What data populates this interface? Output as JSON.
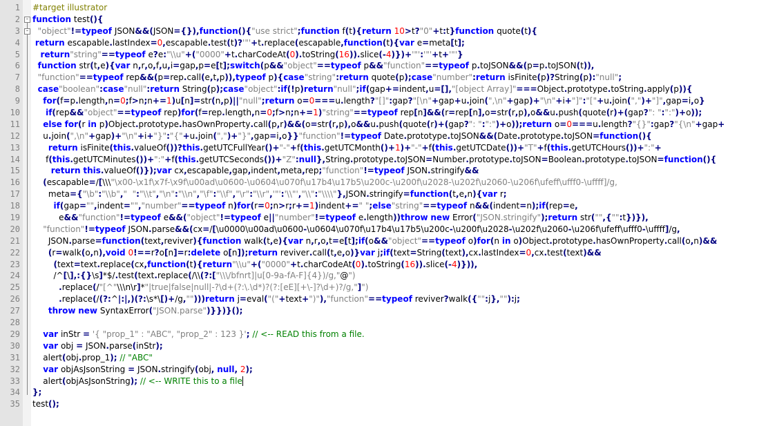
{
  "editor": {
    "title": "",
    "lines": [
      "#target illustrator",
      "function test(){",
      "  \"object\"!=typeof JSON&&(JSON={}),function(){\"use strict\";function f(t){return 10>t?\"0\"+t:t}function quote(t){",
      " return escapable.lastIndex=0,escapable.test(t)?'\"'+t.replace(escapable,function(t){var e=meta[t];",
      "   return\"string\"==typeof e?e:\"\\\\u\"+(\"0000\"+t.charCodeAt(0).toString(16)).slice(-4)})+'\"':'\"'+t+'\"'}",
      "  function str(t,e){var n,r,o,f,u,i=gap,p=e[t];switch(p&&\"object\"==typeof p&&\"function\"==typeof p.toJSON&&(p=p.toJSON(t)),",
      "  \"function\"==typeof rep&&(p=rep.call(e,t,p)),typeof p){case\"string\":return quote(p);case\"number\":return isFinite(p)?String(p):\"null\";",
      "  case\"boolean\":case\"null\":return String(p);case\"object\":if(!p)return\"null\";if(gap+=indent,u=[],\"[object Array]\"===Object.prototype.toString.apply(p)){",
      "    for(f=p.length,n=0;f>n;n+=1)u[n]=str(n,p)||\"null\";return o=0===u.length?\"[]\":gap?\"[\\n\"+gap+u.join(\",\\n\"+gap)+\"\\n\"+i+\"]\":\"[\"+u.join(\",\")+\"]\",gap=i,o}",
      "     if(rep&&\"object\"==typeof rep)for(f=rep.length,n=0;f>n;n+=1)\"string\"==typeof rep[n]&&(r=rep[n],o=str(r,p),o&&u.push(quote(r)+(gap?\": \":\":\")+o));",
      "    else for(r in p)Object.prototype.hasOwnProperty.call(p,r)&&(o=str(r,p),o&&u.push(quote(r)+(gap?\": \":\":\")+o));return o=0===u.length?\"{}\":gap?\"{\\n\"+gap+",
      "    u.join(\",\\n\"+gap)+\"\\n\"+i+\"}\":\"{\"+u.join(\",\")+\"}\",gap=i,o}}\"function\"!=typeof Date.prototype.toJSON&&(Date.prototype.toJSON=function(){",
      "      return isFinite(this.valueOf())?this.getUTCFullYear()+\"-\"+f(this.getUTCMonth()+1)+\"-\"+f(this.getUTCDate())+\"T\"+f(this.getUTCHours())+\":\"+",
      "     f(this.getUTCMinutes())+\":\"+f(this.getUTCSeconds())+\"Z\":null},String.prototype.toJSON=Number.prototype.toJSON=Boolean.prototype.toJSON=function(){",
      "       return this.valueOf()});var cx,escapable,gap,indent,meta,rep;\"function\"!=typeof JSON.stringify&&",
      "    (escapable=/[\\\\\\\"\\x00-\\x1f\\x7f-\\x9f\\u00ad\\u0600-\\u0604\\u070f\\u17b4\\u17b5\\u200c-\\u200f\\u2028-\\u202f\\u2060-\\u206f\\ufeff\\ufff0-\\uffff]/g,",
      "      meta={\"\\b\":\"\\\\b\",\"  \":\"\\\\t\",\"\\n\":\"\\\\n\",\"\\f\":\"\\\\f\",\"\\r\":\"\\\\r\",'\"':'\\\\\"',\"\\\\\":\"\\\\\\\\\"},JSON.stringify=function(t,e,n){var r;",
      "        if(gap=\"\",indent=\"\",\"number\"==typeof n)for(r=0;n>r;r+=1)indent+=\" \";else\"string\"==typeof n&&(indent=n);if(rep=e,",
      "          e&&\"function\"!=typeof e&&(\"object\"!=typeof e||\"number\"!=typeof e.length))throw new Error(\"JSON.stringify\");return str(\"\",{\"\":t})}),",
      "    \"function\"!=typeof JSON.parse&&(cx=/[\\u0000\\u00ad\\u0600-\\u0604\\u070f\\u17b4\\u17b5\\u200c-\\u200f\\u2028-\\u202f\\u2060-\\u206f\\ufeff\\ufff0-\\uffff]/g,",
      "      JSON.parse=function(text,reviver){function walk(t,e){var n,r,o,t=e[t];if(o&&\"object\"==typeof o)for(n in o)Object.prototype.hasOwnProperty.call(o,n)&&",
      "      (r=walk(o,n),void 0!==r?o[n]=r:delete o[n]);return reviver.call(t,e,o)}var j;if(text=String(text),cx.lastIndex=0,cx.test(text)&&",
      "        (text=text.replace(cx,function(t){return\"\\\\u\"+(\"0000\"+t.charCodeAt(0).toString(16)).slice(-4)})),",
      "        /^[\\],:{}\\s]*$/.test(text.replace(/\\\\(?:[\"\\\\\\/bfnrt]|u[0-9a-fA-F]{4})/g,\"@\")",
      "          .replace(/\"[^\"\\\\\\n\\r]*\"|true|false|null|-?\\d+(?:\\.\\d*)?(?:[eE][+\\-]?\\d+)?/g,\"]\")",
      "          .replace(/(?:^|:|,)(?:\\s*\\[)+/g,\"\")))return j=eval(\"(\"+text+\")\"),\"function\"==typeof reviver?walk({\"\":j},\"\"):j;",
      "      throw new SyntaxError(\"JSON.parse\")}})}();",
      "",
      "    var inStr = '{ \"prop_1\" : \"ABC\", \"prop_2\" : 123 }'; // <-- READ this from a file.",
      "    var obj = JSON.parse(inStr);",
      "    alert(obj.prop_1); // \"ABC\"",
      "    var objAsJsonString = JSON.stringify(obj, null, 2);",
      "    alert(objAsJsonString); // <-- WRITE this to a file",
      "};",
      "test();"
    ],
    "line_numbers": [
      "1",
      "2",
      "3",
      "4",
      "5",
      "6",
      "7",
      "8",
      "9",
      "10",
      "11",
      "12",
      "13",
      "14",
      "15",
      "16",
      "17",
      "18",
      "19",
      "20",
      "21",
      "22",
      "23",
      "24",
      "25",
      "26",
      "27",
      "28",
      "29",
      "30",
      "31",
      "32",
      "33",
      "34",
      "35"
    ],
    "fold_markers": [
      "-",
      "-"
    ],
    "colors": {
      "keyword": "#0000ff",
      "string": "#808080",
      "number": "#ff0000",
      "comment": "#008000",
      "directive": "#808000"
    }
  }
}
